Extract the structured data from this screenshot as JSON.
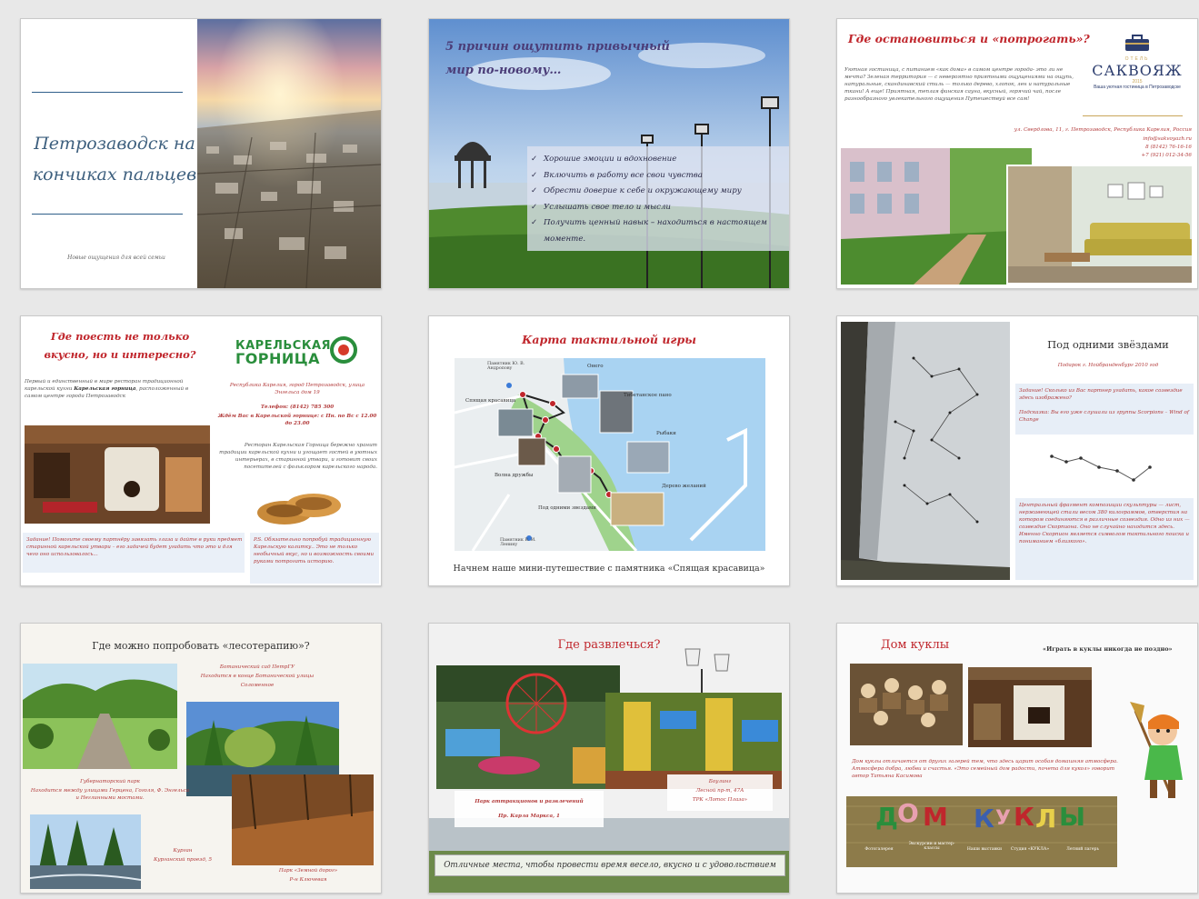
{
  "colors": {
    "accent_red": "#c0262c",
    "accent_blue": "#3d5f7e",
    "accent_green": "#2a8e3c"
  },
  "slides": [
    {
      "id": 1,
      "title": "Петрозаводск на кончиках пальцев",
      "subtitle": "Новые ощущения для всей семьи"
    },
    {
      "id": 2,
      "title": "5 причин ощутить привычный мир по-новому…",
      "items": [
        "Хорошие эмоции и вдохновение",
        "Включить в работу все свои чувства",
        "Обрести доверие к себе и окружающему миру",
        "Услышать свое тело и мысли",
        "Получить ценный навык – находиться в настоящем моменте."
      ]
    },
    {
      "id": 3,
      "title": "Где остановиться и «потрогать»?",
      "body": "Уютная гостиница, с питанием «как дома» в самом центре города- это ли не мечта? Зеленая территория — с невероятно приятными ощущениями на ощупь, натуральные, скандинавский стиль — только дерево, хлопок, лен и натуральные ткани! А еще! Приятная, теплая финская сауна, вкусный, горячий чай, после разнообразного увлекательного ощущения Путешествуй все сам!",
      "logo": {
        "top": "ОТЕЛЬ",
        "name": "САКВОЯЖ",
        "year": "2015",
        "tagline": "Ваша уютная гостиница в Петрозаводске"
      },
      "address": [
        "ул. Свердлова, 11, г. Петрозаводск, Республика Карелия, Россия",
        "info@sakvoyazh.ru",
        "8 (8142) 76-16-16",
        "+7 (921) 012-34-56"
      ]
    },
    {
      "id": 4,
      "title": "Где поесть не только вкусно, но и интересно?",
      "logo": {
        "line1": "КАРЕЛЬСКАЯ",
        "line2": "ГОРНИЦА"
      },
      "intro_a": "Первый и единственный в мире ресторан традиционной карельской кухни ",
      "intro_b": "Карельская горница",
      "intro_c": ", расположенный в самом центре города Петрозаводск",
      "contacts": [
        "Республика Карелия, город Петрозаводск, улица Энгельса дом 19",
        "Телефон: (8142) 785 300",
        "Ждём Вас в Карельской горнице: с Пн. по Вс с 12.00 до 23.00"
      ],
      "about": "Ресторан Карельская Горница бережно хранит традиции карельской кухни и угощает гостей в уютных интерьерах, в старинной утвари, и готовит своих посетителей с фольклором карельского народа.",
      "task": "Задание! Помогите своему партнёру завязать глаза и дайте в руки предмет старинной карельской утвари – его задачей будет угадать что это и для чего оно использовалось...",
      "ps": "P.S. Обязательно попробуй традиционную Карельскую калитку.. Это не только необычный вкус, но и возможность своими руками потрогать историю."
    },
    {
      "id": 5,
      "title": "Карта тактильной игры",
      "footer": "Начнем наше мини-путешествие с памятника «Спящая красавица»",
      "map_labels": [
        "Онего",
        "Спящая красавица",
        "Тибетанское пано",
        "Рыбаки",
        "Волна дружбы",
        "Дерево желаний",
        "Под одними звездами",
        "Памятник Ю. В. Андропову",
        "Памятник В. И. Ленину"
      ]
    },
    {
      "id": 6,
      "title": "Под одними звёздами",
      "subtitle": "Подарок г. Нойбранденбург 2010 год",
      "task": "Задание! Сколько из Вас партнер угадать, какое созвездие здесь изображено?",
      "hint": "Подсказка: Вы его уже слушали из группы Scorpions – Wind of Change",
      "desc": "Центральный фрагмент композиции скульптуры — лист, нержавеющей стали весом 380 килограммов, отверстия на котором соединяются в различные созвездия. Одно из них — созвездие Скорпиона. Оно не случайно находится здесь. Именно Скорпион является символом тактильного поиска и пониманием «близкого»."
    },
    {
      "id": 7,
      "title": "Где можно попробовать «лесотерапию»?",
      "p1": [
        "Ботанический сад ПетрГУ",
        "Находится в конце Ботанической улицы",
        "Соломенное"
      ],
      "p2": [
        "Губернаторский парк",
        "Находится между улицами Герцена, Гоголя, Ф. Энгельса и Неглинными мостами."
      ],
      "p3": [
        "Курган",
        "Курганский проезд, 5"
      ],
      "p4": [
        "Парк «Земной дорог»",
        "Р-н Ключевая"
      ]
    },
    {
      "id": 8,
      "title": "Где развлечься?",
      "left_caption": [
        "Парк аттракционов и развлечений",
        "Пр. Карла Маркса, 1"
      ],
      "right_caption": [
        "Боулинг",
        "Лесной пр-т, 47А",
        "ТРК «Лотос Плаза»"
      ],
      "footer": "Отличные места, чтобы провести время весело, вкусно и с удовольствием"
    },
    {
      "id": 9,
      "title": "Дом куклы",
      "subtitle": "«Играть в куклы никогда не поздно»",
      "body": "Дом куклы отличается от других галерей тем, что здесь царит особая домашняя атмосфера. Атмосфера добра, любви и счастья. «Это семейный дом радости, почета для кукол» говорит автор Татьяна Касимова",
      "banner": {
        "letters": [
          "Д",
          "О",
          "М",
          "К",
          "У",
          "К",
          "Л",
          "Ы"
        ],
        "captions": [
          "Фотогалерея",
          "Экскурсии и мастер-классы",
          "Наши выставки",
          "Студия «КУКЛА»",
          "Летний лагерь"
        ]
      }
    }
  ]
}
